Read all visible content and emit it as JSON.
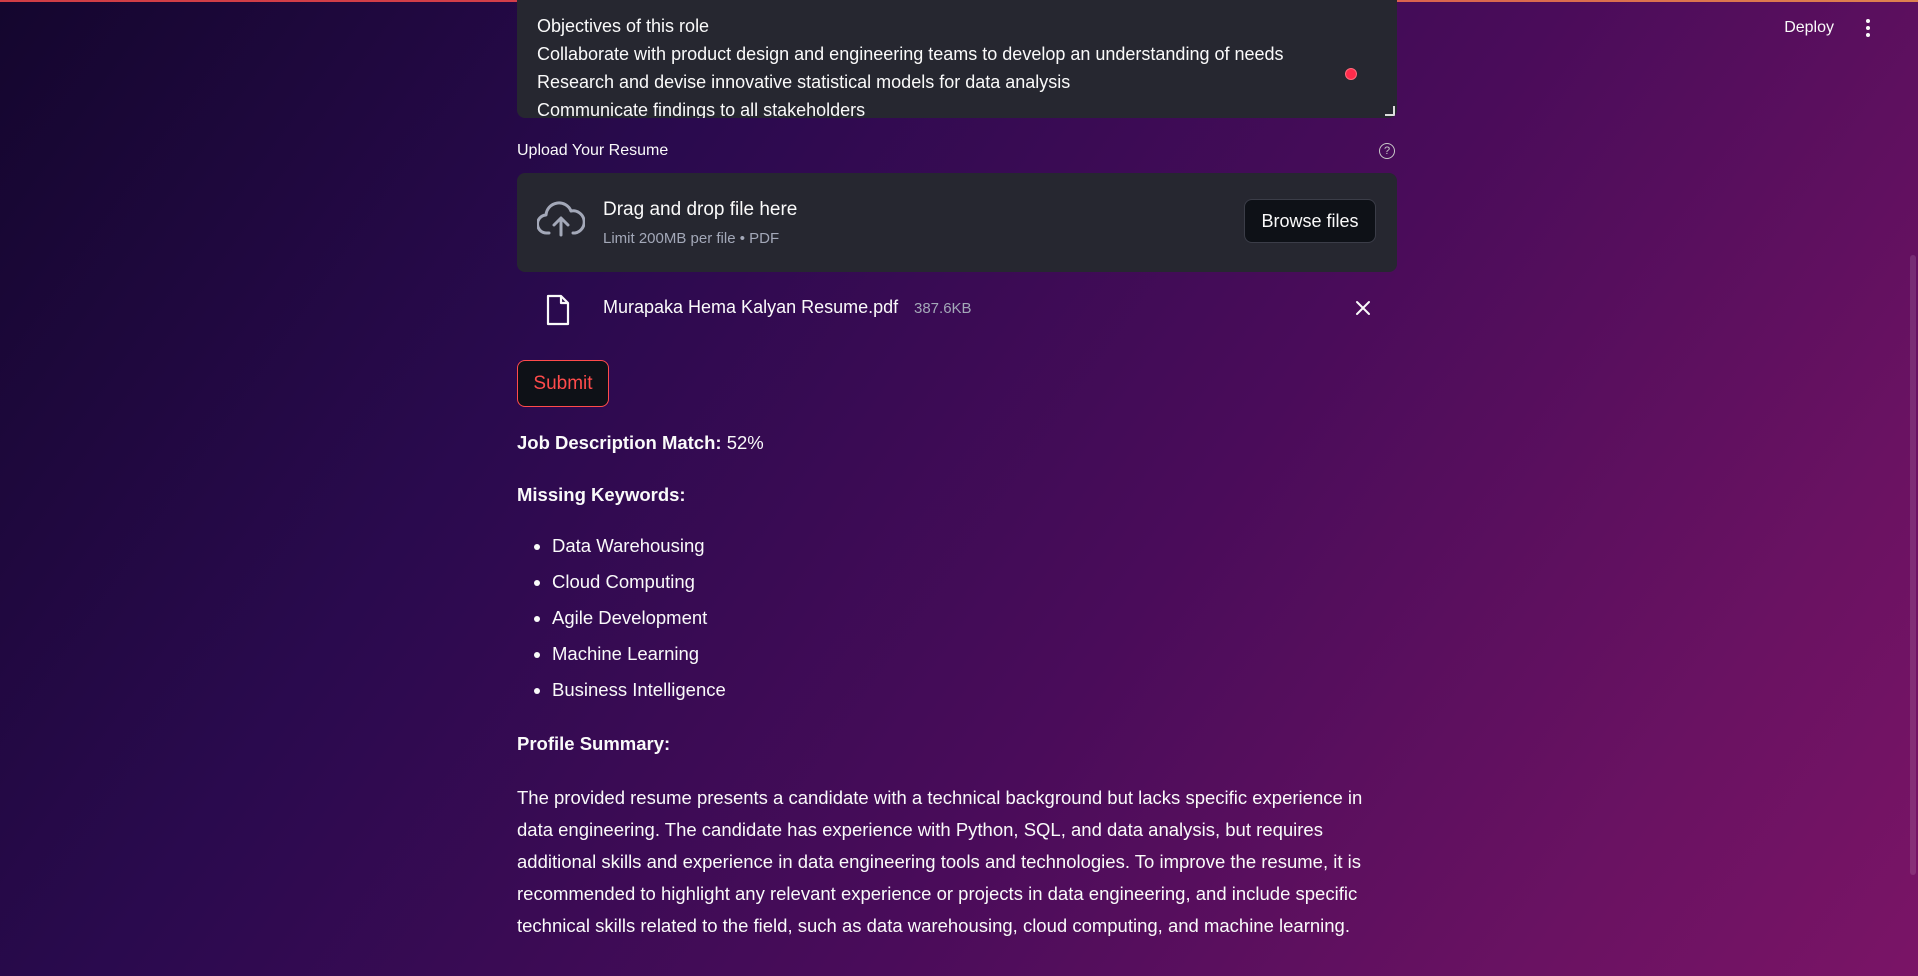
{
  "header": {
    "deploy_label": "Deploy",
    "menu_icon": "kebab-menu-icon"
  },
  "job_description": {
    "lines": [
      "Objectives of this role",
      "Collaborate with product design and engineering teams to develop an understanding of needs",
      "Research and devise innovative statistical models for data analysis",
      "Communicate findings to all stakeholders"
    ]
  },
  "uploader": {
    "label": "Upload Your Resume",
    "drop_title": "Drag and drop file here",
    "drop_subtitle": "Limit 200MB per file • PDF",
    "browse_label": "Browse files",
    "file": {
      "name": "Murapaka Hema Kalyan Resume.pdf",
      "size": "387.6KB"
    }
  },
  "submit_label": "Submit",
  "results": {
    "match_label": "Job Description Match:",
    "match_value": "52%",
    "missing_label": "Missing Keywords:",
    "keywords": [
      "Data Warehousing",
      "Cloud Computing",
      "Agile Development",
      "Machine Learning",
      "Business Intelligence"
    ],
    "summary_label": "Profile Summary:",
    "summary_text": "The provided resume presents a candidate with a technical background but lacks specific experience in data engineering. The candidate has experience with Python, SQL, and data analysis, but requires additional skills and experience in data engineering tools and technologies. To improve the resume, it is recommended to highlight any relevant experience or projects in data engineering, and include specific technical skills related to the field, such as data warehousing, cloud computing, and machine learning."
  },
  "colors": {
    "accent": "#ff4b4b",
    "panel": "#262730",
    "muted_text": "#a3a8b8"
  }
}
